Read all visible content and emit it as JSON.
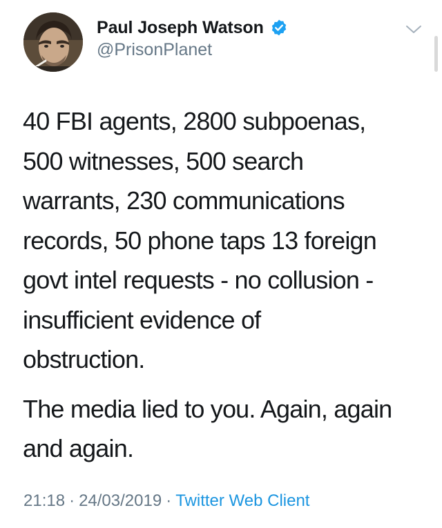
{
  "author": {
    "display_name": "Paul Joseph Watson",
    "handle": "@PrisonPlanet",
    "verified": true,
    "avatar_icon": "profile-photo"
  },
  "tweet": {
    "paragraphs": [
      "40 FBI agents, 2800 subpoenas,\n500 witnesses, 500 search\nwarrants, 230 communications\nrecords, 50 phone taps 13 foreign\ngovt intel requests - no collusion -\ninsufficient evidence of\nobstruction.",
      "The media lied to you. Again, again\nand again."
    ]
  },
  "meta": {
    "time": "21:18",
    "date": "24/03/2019",
    "separator": "·",
    "client": "Twitter Web Client"
  },
  "icons": {
    "verified": "verified-badge-icon",
    "menu": "chevron-down-icon"
  },
  "colors": {
    "text": "#14171a",
    "secondary": "#657786",
    "accent": "#1b95e0"
  }
}
